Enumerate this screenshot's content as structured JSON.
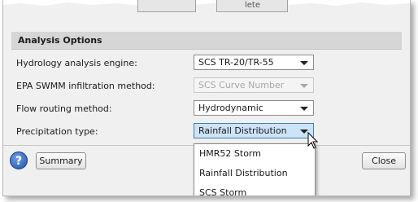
{
  "tabs_fragment": {
    "label_partial": "lete"
  },
  "section": {
    "title": "Analysis Options"
  },
  "fields": [
    {
      "label": "Hydrology analysis engine:",
      "value": "SCS TR-20/TR-55"
    },
    {
      "label": "EPA SWMM infiltration method:",
      "value": "SCS Curve Number"
    },
    {
      "label": "Flow routing method:",
      "value": "Hydrodynamic"
    },
    {
      "label": "Precipitation type:",
      "value": "Rainfall Distribution"
    }
  ],
  "dropdown_options": [
    "HMR52 Storm",
    "Rainfall Distribution",
    "SCS Storm"
  ],
  "footer": {
    "help": "?",
    "summary": "Summary",
    "close": "Close"
  },
  "colors": {
    "section_bg": "#d6d6d6",
    "active_combo": "#cde3f7",
    "help_blue": "#1f4fa8"
  }
}
